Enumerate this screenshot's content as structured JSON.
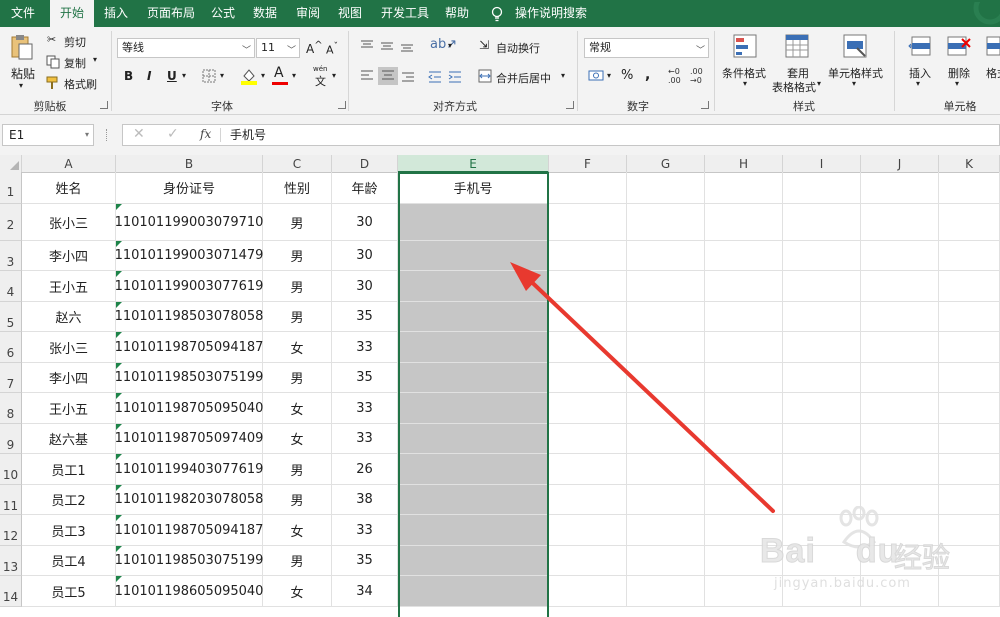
{
  "menu": {
    "tabs": [
      "文件",
      "开始",
      "插入",
      "页面布局",
      "公式",
      "数据",
      "审阅",
      "视图",
      "开发工具",
      "帮助"
    ],
    "active_tab": "开始",
    "tell_me": "操作说明搜索"
  },
  "ribbon": {
    "clipboard": {
      "group": "剪贴板",
      "paste": "粘贴",
      "cut": "剪切",
      "copy": "复制",
      "format_painter": "格式刷"
    },
    "font": {
      "group": "字体",
      "font_name": "等线",
      "font_size": "11",
      "bold": "B",
      "italic": "I",
      "underline": "U",
      "grow": "A",
      "shrink": "A",
      "font_color_letter": "A",
      "wen": "wén",
      "wen_char": "文"
    },
    "alignment": {
      "group": "对齐方式",
      "wrap": "自动换行",
      "merge": "合并后居中"
    },
    "number": {
      "group": "数字",
      "format": "常规",
      "percent": "%",
      "comma": ","
    },
    "styles": {
      "group": "样式",
      "conditional": "条件格式",
      "table_fmt_1": "套用",
      "table_fmt_2": "表格格式",
      "cell_styles": "单元格样式"
    },
    "cells": {
      "group": "单元格",
      "insert": "插入",
      "delete": "删除",
      "format": "格式"
    }
  },
  "formula_bar": {
    "name_box": "E1",
    "fx": "fx",
    "content": "手机号"
  },
  "columns": [
    "A",
    "B",
    "C",
    "D",
    "E",
    "F",
    "G",
    "H",
    "I",
    "J",
    "K"
  ],
  "rows": [
    "1",
    "2",
    "3",
    "4",
    "5",
    "6",
    "7",
    "8",
    "9",
    "10",
    "11",
    "12",
    "13",
    "14"
  ],
  "table": {
    "headers": [
      "姓名",
      "身份证号",
      "性别",
      "年龄",
      "手机号"
    ],
    "rows": [
      [
        "张小三",
        "110101199003079710",
        "男",
        "30",
        ""
      ],
      [
        "李小四",
        "110101199003071479",
        "男",
        "30",
        ""
      ],
      [
        "王小五",
        "110101199003077619",
        "男",
        "30",
        ""
      ],
      [
        "赵六",
        "110101198503078058",
        "男",
        "35",
        ""
      ],
      [
        "张小三",
        "110101198705094187",
        "女",
        "33",
        ""
      ],
      [
        "李小四",
        "110101198503075199",
        "男",
        "35",
        ""
      ],
      [
        "王小五",
        "110101198705095040",
        "女",
        "33",
        ""
      ],
      [
        "赵六基",
        "110101198705097409",
        "女",
        "33",
        ""
      ],
      [
        "员工1",
        "110101199403077619",
        "男",
        "26",
        ""
      ],
      [
        "员工2",
        "110101198203078058",
        "男",
        "38",
        ""
      ],
      [
        "员工3",
        "110101198705094187",
        "女",
        "33",
        ""
      ],
      [
        "员工4",
        "110101198503075199",
        "男",
        "35",
        ""
      ],
      [
        "员工5",
        "110101198605095040",
        "女",
        "34",
        ""
      ]
    ]
  },
  "watermark": {
    "brand": "Bai",
    "brand2": "du",
    "jingyan": "经验",
    "url": "jingyan.baidu.com"
  },
  "colors": {
    "excel_green": "#217346",
    "selected_fill": "#c6c6c6",
    "annotation_arrow": "#e8392f"
  }
}
